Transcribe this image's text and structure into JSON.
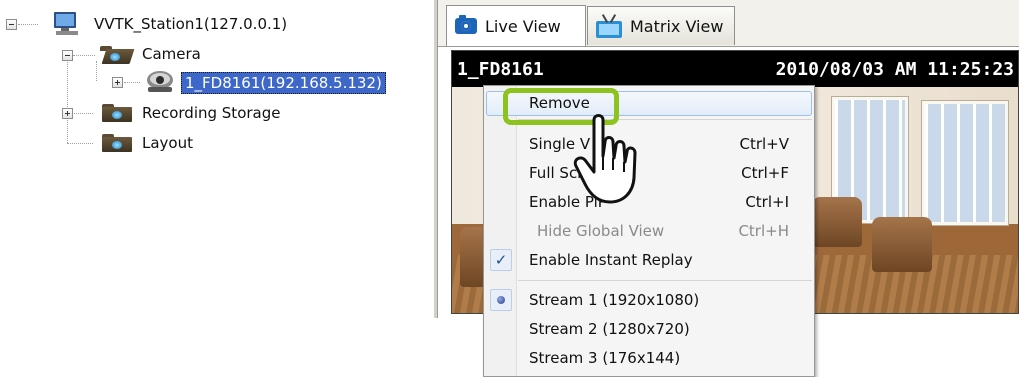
{
  "tree": {
    "station_label": "VVTK_Station1(127.0.0.1)",
    "camera_folder_label": "Camera",
    "camera_item_label": "1_FD8161(192.168.5.132)",
    "recording_storage_label": "Recording Storage",
    "layout_label": "Layout"
  },
  "tabs": [
    {
      "label": "Live View",
      "icon": "camera-icon"
    },
    {
      "label": "Matrix View",
      "icon": "tv-icon"
    }
  ],
  "video": {
    "camera_name": "1_FD8161",
    "timestamp": "2010/08/03 AM 11:25:23"
  },
  "context_menu": {
    "items": [
      {
        "label": "Remove",
        "shortcut": "",
        "highlighted": true
      },
      {
        "label": "Single V",
        "shortcut": "Ctrl+V"
      },
      {
        "label": "Full Scre",
        "shortcut": "Ctrl+F"
      },
      {
        "label": "Enable PiP",
        "shortcut": "Ctrl+I"
      },
      {
        "label": "Hide Global View",
        "shortcut": "Ctrl+H",
        "disabled": true
      },
      {
        "label": "Enable Instant Replay",
        "shortcut": "",
        "checked": true
      },
      {
        "label": "Stream 1 (1920x1080)",
        "shortcut": "",
        "selected": true
      },
      {
        "label": "Stream 2 (1280x720)",
        "shortcut": ""
      },
      {
        "label": "Stream 3 (176x144)",
        "shortcut": ""
      }
    ]
  },
  "colors": {
    "selection": "#3d67c9",
    "highlight_box": "#8dc21f",
    "tab_icon_blue": "#1d65b8"
  }
}
